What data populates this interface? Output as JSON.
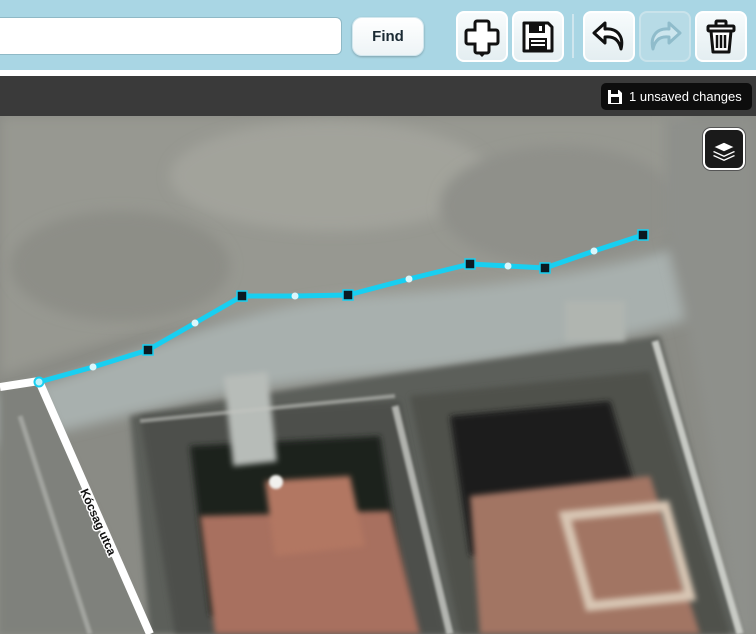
{
  "search": {
    "value": "",
    "placeholder": ""
  },
  "toolbar": {
    "find_label": "Find",
    "tools": [
      {
        "name": "add-feature",
        "icon": "add-icon"
      },
      {
        "name": "save",
        "icon": "save-icon"
      },
      {
        "name": "undo",
        "icon": "undo-icon"
      },
      {
        "name": "redo",
        "icon": "redo-icon",
        "disabled": true
      },
      {
        "name": "delete",
        "icon": "trash-icon"
      }
    ]
  },
  "status": {
    "unsaved_changes": "1 unsaved changes"
  },
  "map": {
    "street_label": "Kócsag utca",
    "layers_icon": "layers-icon",
    "selected_way_color": "#18cff1"
  }
}
